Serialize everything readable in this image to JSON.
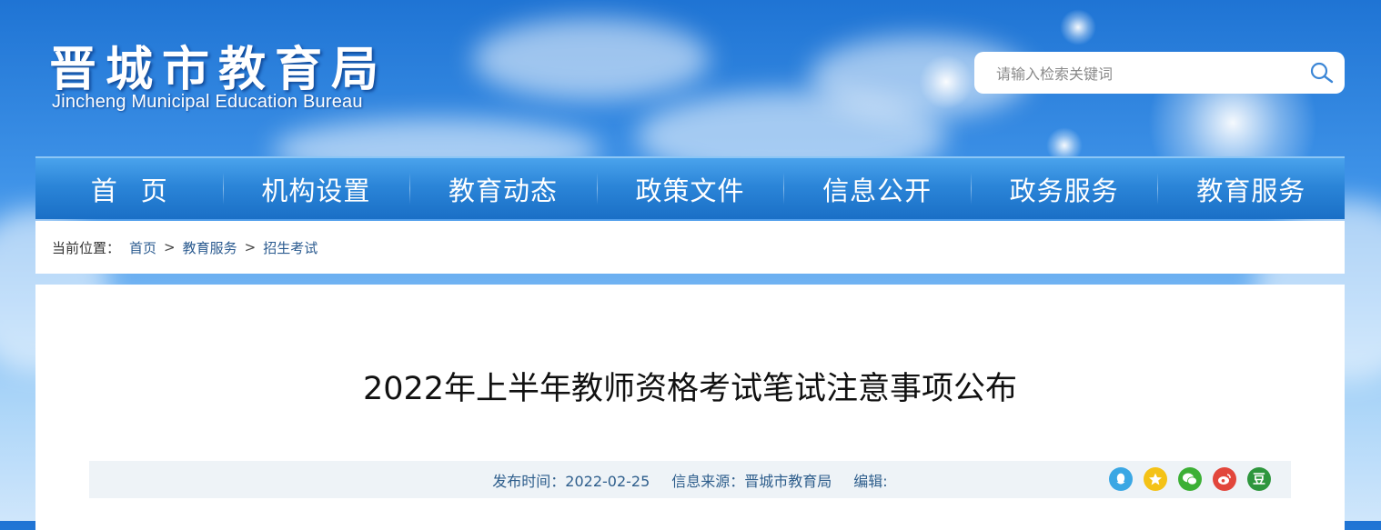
{
  "header": {
    "logo_cn": "晋城市教育局",
    "logo_en": "Jincheng Municipal Education Bureau"
  },
  "search": {
    "placeholder": "请输入检索关键词",
    "icon": "search-icon"
  },
  "nav": {
    "items": [
      {
        "label": "首页"
      },
      {
        "label": "机构设置"
      },
      {
        "label": "教育动态"
      },
      {
        "label": "政策文件"
      },
      {
        "label": "信息公开"
      },
      {
        "label": "政务服务"
      },
      {
        "label": "教育服务"
      }
    ]
  },
  "breadcrumb": {
    "prefix": "当前位置：",
    "items": [
      "首页",
      "教育服务",
      "招生考试"
    ],
    "separator": ">"
  },
  "article": {
    "title": "2022年上半年教师资格考试笔试注意事项公布",
    "publish_time": "发布时间：2022-02-25",
    "source": "信息来源：晋城市教育局",
    "editor": "编辑:"
  },
  "share": {
    "buttons": [
      {
        "name": "qq-share-icon",
        "color": "#3aa7e4"
      },
      {
        "name": "qzone-share-icon",
        "color": "#f4c216"
      },
      {
        "name": "wechat-share-icon",
        "color": "#3cb035"
      },
      {
        "name": "weibo-share-icon",
        "color": "#e2463b"
      },
      {
        "name": "douban-share-icon",
        "color": "#2e963d",
        "glyph": "豆"
      }
    ]
  },
  "colors": {
    "nav_bg": "#2b85d8",
    "link": "#2a5a8f",
    "meta_bg": "#eef3f7"
  }
}
